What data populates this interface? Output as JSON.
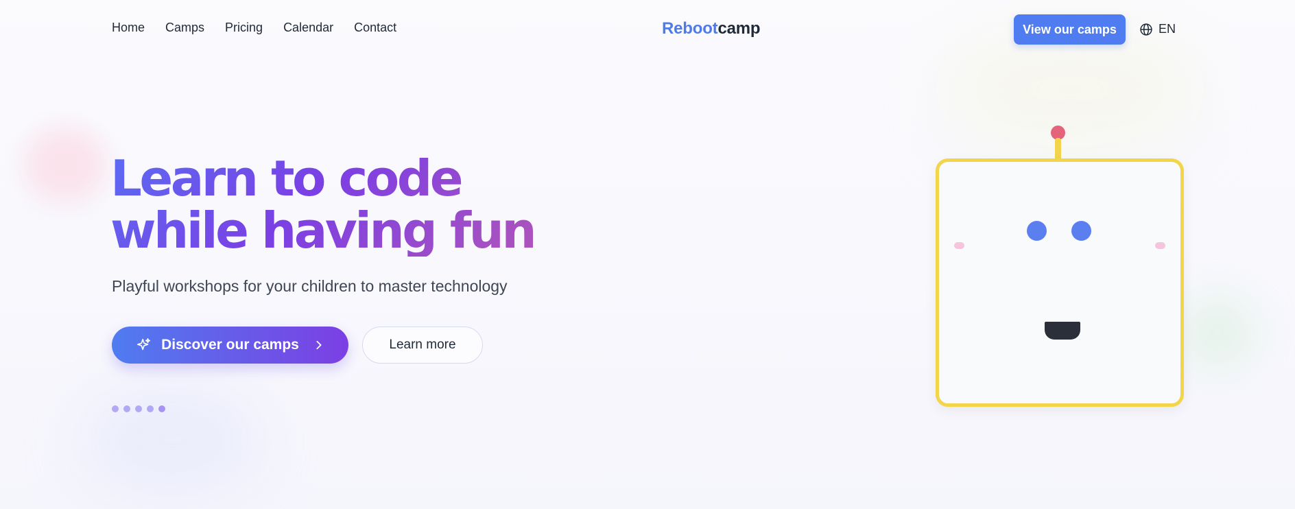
{
  "nav": {
    "links": [
      "Home",
      "Camps",
      "Pricing",
      "Calendar",
      "Contact"
    ],
    "logo_part1": "Reboot",
    "logo_part2": "camp",
    "cta_label": "View our camps",
    "language": "EN"
  },
  "hero": {
    "title_line1": "Learn to code",
    "title_line2": "while having fun",
    "subtitle": "Playful workshops for your children to master technology",
    "primary_button": "Discover our camps",
    "secondary_button": "Learn more",
    "carousel_dot_count": 5
  },
  "icons": {
    "language": "globe-icon",
    "primary_button": "sparkles-icon",
    "primary_button_arrow": "chevron-right-icon"
  },
  "colors": {
    "brand_blue": "#4f7cf0",
    "brand_purple": "#7c3fe3",
    "robot_frame": "#f2d54a",
    "robot_eyes": "#5b7fee",
    "antenna_ball": "#e4647a"
  }
}
